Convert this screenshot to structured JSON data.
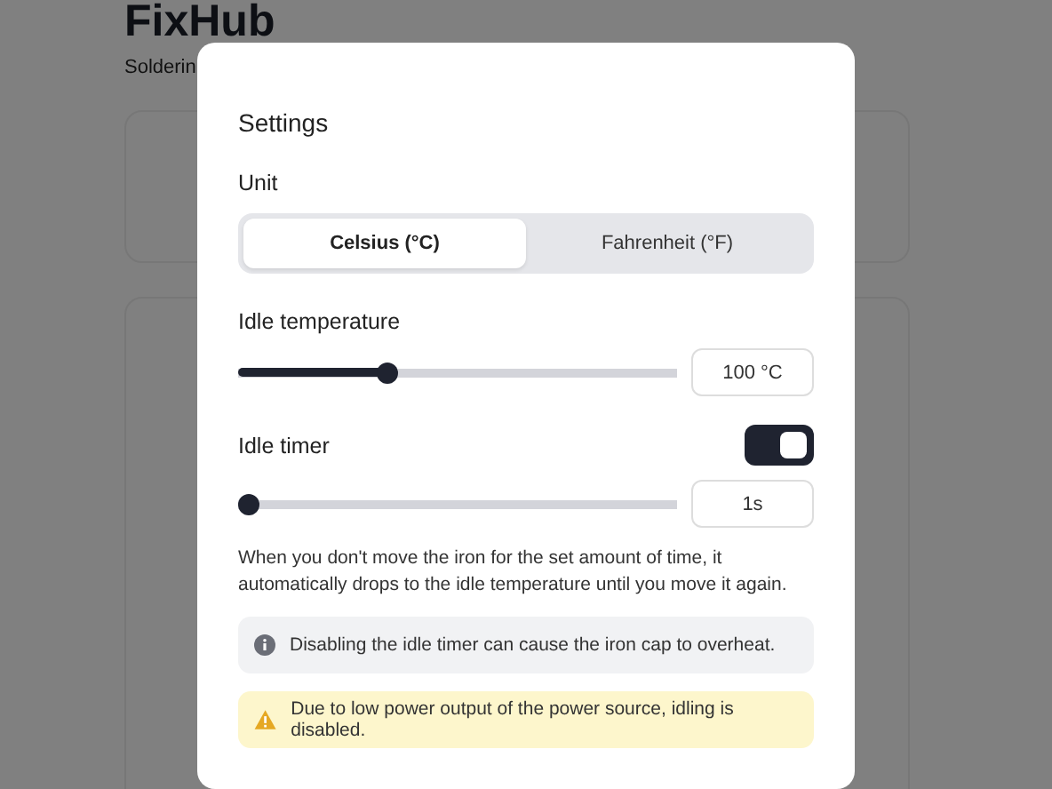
{
  "page": {
    "title": "FixHub",
    "subtitle": "Solderin"
  },
  "dialog": {
    "title": "Settings",
    "unit": {
      "label": "Unit",
      "options": [
        {
          "label": "Celsius (°C)",
          "selected": true
        },
        {
          "label": "Fahrenheit (°F)",
          "selected": false
        }
      ]
    },
    "idle_temperature": {
      "label": "Idle temperature",
      "level": 0.33,
      "value": "100 °C"
    },
    "idle_timer": {
      "label": "Idle timer",
      "on": true,
      "level": 0,
      "value": "1s"
    },
    "description": "When you don't move the iron for the set amount of time, it automatically drops to the idle temperature until you move it again.",
    "notices": [
      {
        "kind": "info",
        "text": "Disabling the idle timer can cause the iron cap to overheat."
      },
      {
        "kind": "warning",
        "text": "Due to low power output of the power source, idling is disabled."
      }
    ]
  }
}
